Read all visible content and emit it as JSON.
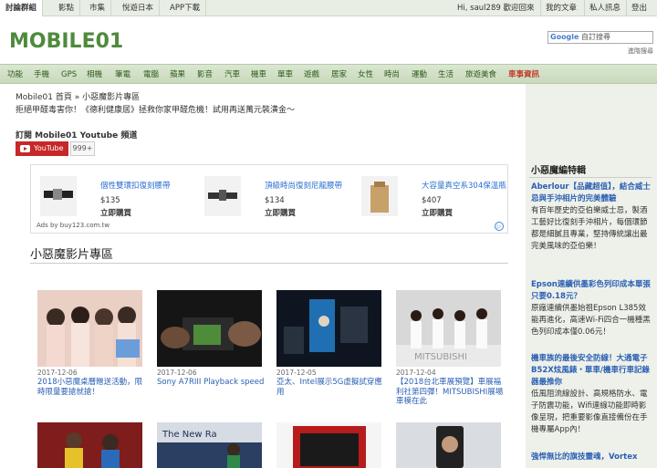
{
  "topbar": {
    "tabs": [
      "討論群組",
      "影點",
      "市集",
      "悅遊日本",
      "APP下載"
    ],
    "greeting": "Hi, saul289 歡迎回來",
    "links": [
      "我的文章",
      "私人訊息",
      "登出"
    ]
  },
  "header": {
    "logo_text": "MOBILE01",
    "search_brand": "Google",
    "search_placeholder": "自訂搜尋",
    "advanced_search": "進階搜尋"
  },
  "nav": {
    "items": [
      "功能",
      "手機",
      "GPS",
      "相機",
      "筆電",
      "電腦",
      "蘋果",
      "影音",
      "汽車",
      "機車",
      "單車",
      "遊戲",
      "居家",
      "女性",
      "時尚",
      "運動",
      "生活",
      "旅遊美食",
      "車事資訊"
    ]
  },
  "page": {
    "breadcrumb": "Mobile01 首頁 » 小惡魔影片專區",
    "subtitle": "拒絕甲醛毒害你！《德利健康居》拯救你家甲醛危機！試用再送萬元裝潢金～",
    "subscribe_label": "訂閱 Mobile01 Youtube 頻道",
    "youtube_label": "YouTube",
    "subscriber_count": "999+"
  },
  "ads": {
    "items": [
      {
        "title": "個性雙環扣復刻腰帶",
        "price": "$135",
        "buy": "立即購買"
      },
      {
        "title": "頂級時尚復刻尼龍腰帶",
        "price": "$134",
        "buy": "立即購買"
      },
      {
        "title": "大容量真空系304保溫瓶",
        "price": "$407",
        "buy": "立即購買"
      }
    ],
    "ads_by": "Ads by buy123.com.tw"
  },
  "videos": {
    "section_title": "小惡魔影片專區",
    "items": [
      {
        "date": "2017-12-06",
        "title": "2018小惡魔桌曆贈送活動，限時限量要搶就搶！"
      },
      {
        "date": "2017-12-06",
        "title": "Sony A7RIII Playback speed"
      },
      {
        "date": "2017-12-05",
        "title": "亞太、Intel展示5G虛擬試穿應用"
      },
      {
        "date": "2017-12-04",
        "title": "【2018台北車展預覽】車展福利社第四彈！MITSUBISHI展場車模在此"
      }
    ],
    "thumb_caption": "MITSUBISHI",
    "thumb2_caption": "The New Ra"
  },
  "sidebar": {
    "title": "小惡魔編特輯",
    "items": [
      {
        "headline": "Aberlour【品藏超值】，結合威士忌與手沖相片的完美體驗",
        "desc": "有百年歷史的亞伯樂威士忌，製酒工藝好比復刻手沖相片，每個環節都是細膩且專業，堅持傳統讓出最完美風味的亞伯樂！"
      },
      {
        "headline": "Epson連續供墨彩色列印成本單張只要0.18元？",
        "desc": "原廠連續供墨始祖Epson L385效能再進化，高速Wi-Fi四合一機種黑色列印成本僅0.06元！"
      },
      {
        "headline": "機車族的最後安全防線！大通電子B52X炫風錶・單車/機車行車記錄器最推你",
        "desc": "低風阻流線設計、高規格防水、電子防震功能，Wifi連線功能即時影像呈現，把重要影像直接備份在手機專屬App內！"
      },
      {
        "headline": "強悍無比的旗技靈魂，Vortex"
      }
    ]
  },
  "colors": {
    "nav_bg": "#c8d9bb",
    "link_blue": "#2a5fb4",
    "youtube_red": "#c62828",
    "sidebar_bg": "#eef1ea"
  }
}
